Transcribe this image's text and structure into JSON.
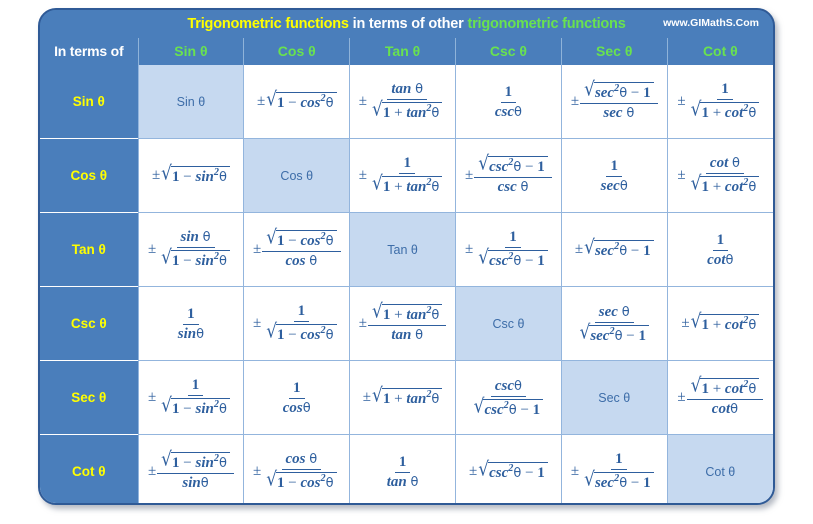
{
  "header": {
    "title_part1": "Trigonometric functions",
    "title_part2": " in terms of other ",
    "title_part3": "trigonometric functions",
    "website": "www.GIMathS.Com",
    "colors": {
      "panel_blue": "#4a7ebb",
      "border_blue": "#2f5a96",
      "title_yellow": "#ffff00",
      "title_green": "#69e24f",
      "diagonal_cell": "#c6d9f0",
      "formula_text": "#2e5f9e"
    }
  },
  "table": {
    "corner_label": "In terms of",
    "columns": [
      "Sin θ",
      "Cos θ",
      "Tan θ",
      "Csc θ",
      "Sec θ",
      "Cot θ"
    ],
    "rows": [
      {
        "label": "Sin θ",
        "diag_index": 0,
        "cells": [
          "Sin θ",
          "±√(1 − cos²θ)",
          "± tan θ / √(1 + tan²θ)",
          "1 / cscθ",
          "± √(sec²θ − 1) / sec θ",
          "± 1 / √(1 + cot²θ)"
        ]
      },
      {
        "label": "Cos θ",
        "diag_index": 1,
        "cells": [
          "±√(1 − sin²θ)",
          "Cos θ",
          "± 1 / √(1 + tan²θ)",
          "± √(csc²θ − 1) / csc θ",
          "1 / secθ",
          "± cot θ / √(1 + cot²θ)"
        ]
      },
      {
        "label": "Tan θ",
        "diag_index": 2,
        "cells": [
          "± sin θ / √(1 − sin²θ)",
          "± √(1 − cos²θ) / cos θ",
          "Tan θ",
          "± 1 / √(csc²θ − 1)",
          "±√(sec²θ − 1)",
          "1 / cotθ"
        ]
      },
      {
        "label": "Csc θ",
        "diag_index": 3,
        "cells": [
          "1 / sinθ",
          "± 1 / √(1 − cos²θ)",
          "± √(1 + tan²θ) / tan θ",
          "Csc θ",
          "sec θ / √(sec²θ − 1)",
          "±√(1 + cot²θ)"
        ]
      },
      {
        "label": "Sec θ",
        "diag_index": 4,
        "cells": [
          "± 1 / √(1 − sin²θ)",
          "1 / cosθ",
          "±√(1 + tan²θ)",
          "cscθ / √(csc²θ − 1)",
          "Sec θ",
          "± √(1 + cot²θ) / cotθ"
        ]
      },
      {
        "label": "Cot θ",
        "diag_index": 5,
        "cells": [
          "± √(1 − sin²θ) / sinθ",
          "± cos θ / √(1 − cos²θ)",
          "1 / tan θ",
          "±√(csc²θ − 1)",
          "± 1 / √(sec²θ − 1)",
          "Cot θ"
        ]
      }
    ]
  }
}
